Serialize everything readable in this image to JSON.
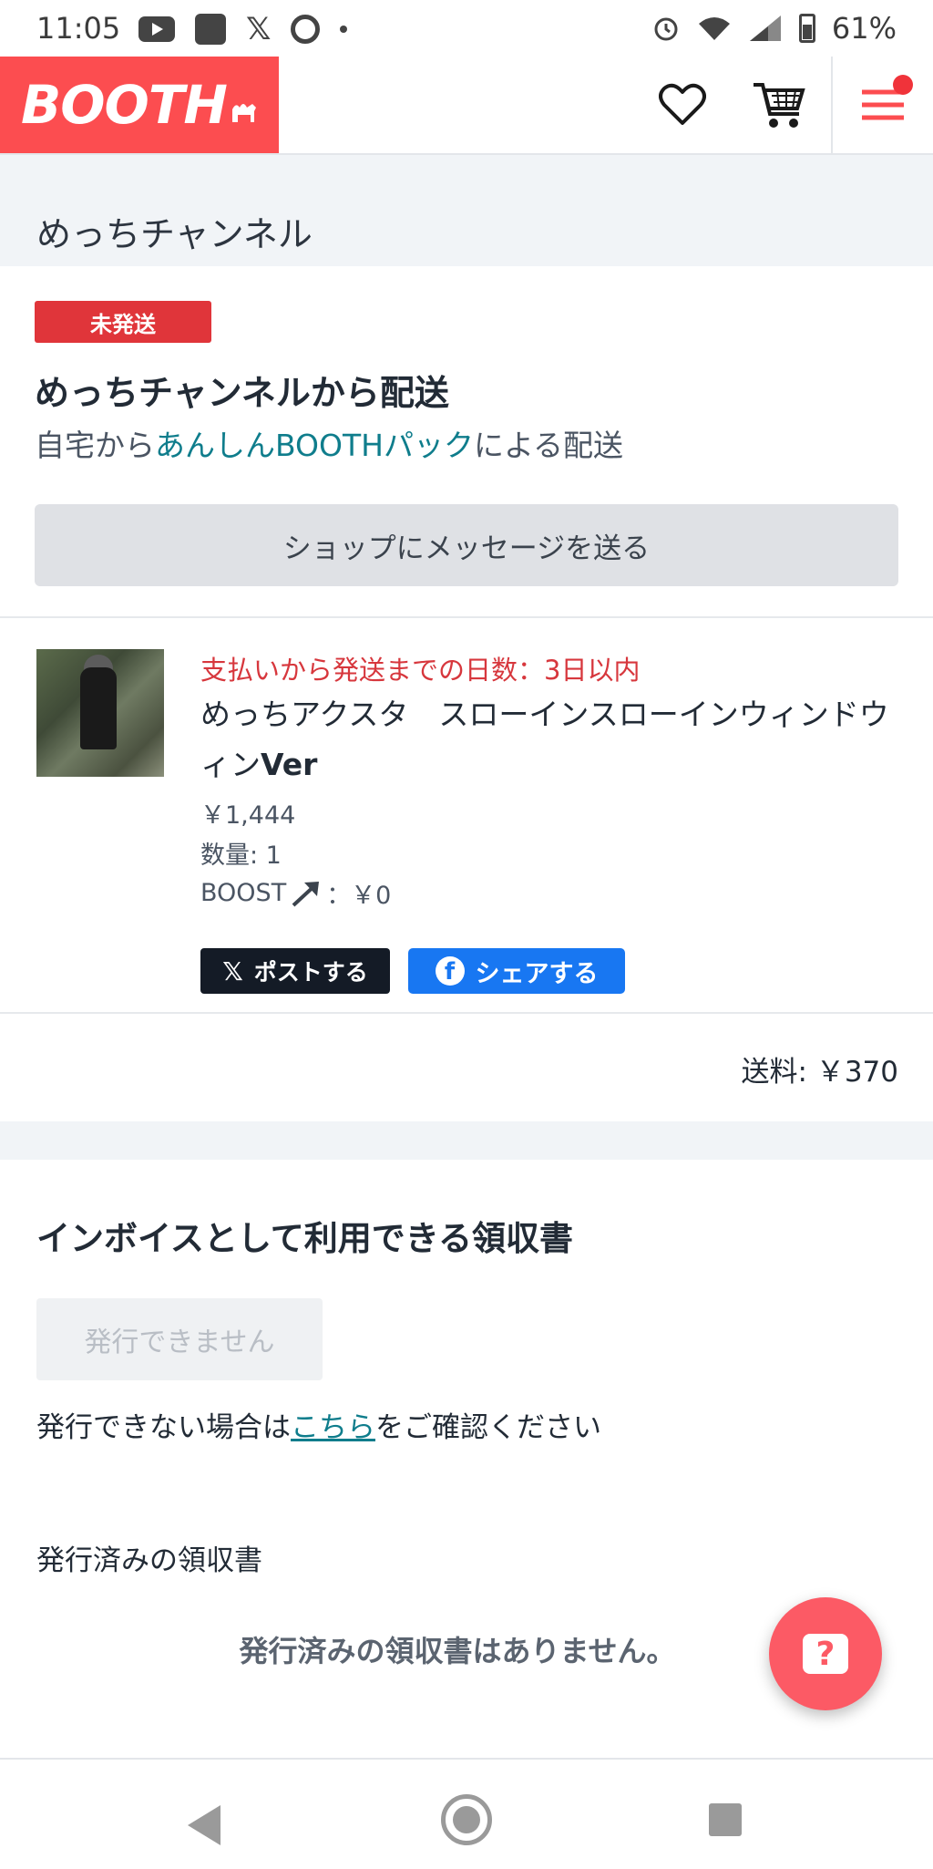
{
  "status_bar": {
    "time": "11:05",
    "battery": "61%"
  },
  "header": {
    "logo": "BOOTH"
  },
  "shop": {
    "name": "めっちチャンネル"
  },
  "shipment": {
    "badge": "未発送",
    "title": "めっちチャンネルから配送",
    "sub_prefix": "自宅から",
    "sub_link": "あんしんBOOTHパック",
    "sub_suffix": "による配送",
    "message_button": "ショップにメッセージを送る"
  },
  "item": {
    "leadtime": "支払いから発送までの日数：3日以内",
    "title_main": "めっちアクスタ　スローインスローインウィンドウィン",
    "title_bold": "Ver",
    "price": "￥1,444",
    "quantity": "数量: 1",
    "boost_label": "BOOST",
    "boost_value": "：￥0",
    "share_x": "ポストする",
    "share_fb": "シェアする"
  },
  "shipping_fee": "送料: ￥370",
  "invoice": {
    "title": "インボイスとして利用できる領収書",
    "issue_button": "発行できません",
    "note_prefix": "発行できない場合は",
    "note_link": "こちら",
    "note_suffix": "をご確認ください",
    "issued_heading": "発行済みの領収書",
    "issued_empty": "発行済みの領収書はありません。"
  },
  "colors": {
    "brand": "#fc4d50",
    "accent_link": "#0f7d8c",
    "badge": "#e0353a",
    "facebook": "#1877f2"
  }
}
